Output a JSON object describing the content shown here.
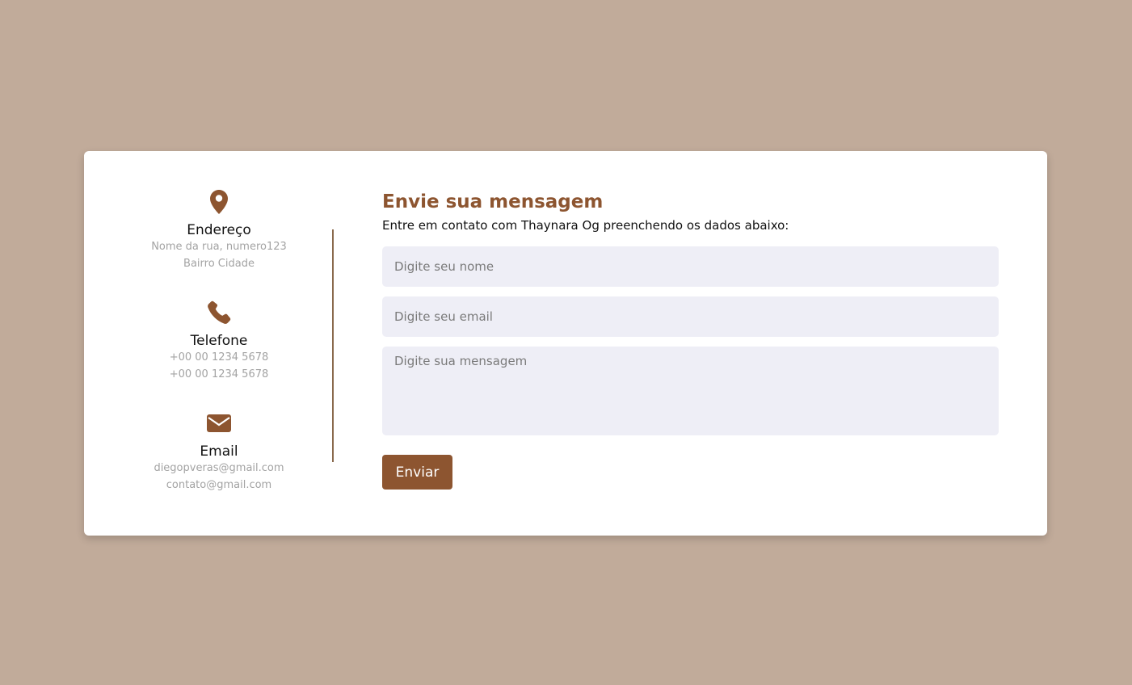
{
  "colors": {
    "background": "#c1ab9a",
    "accent": "#8d5530",
    "field_bg": "#eeeef6",
    "muted_text": "#a3a3a3"
  },
  "contact_info": {
    "address": {
      "icon": "map-pin-icon",
      "title": "Endereço",
      "lines": [
        "Nome da rua, numero123",
        "Bairro Cidade"
      ]
    },
    "phone": {
      "icon": "phone-icon",
      "title": "Telefone",
      "lines": [
        "+00 00 1234 5678",
        "+00 00 1234 5678"
      ]
    },
    "email": {
      "icon": "envelope-icon",
      "title": "Email",
      "lines": [
        "diegopveras@gmail.com",
        "contato@gmail.com"
      ]
    }
  },
  "form": {
    "title": "Envie sua mensagem",
    "subtitle": "Entre em contato com Thaynara Og preenchendo os dados abaixo:",
    "name_placeholder": "Digite seu nome",
    "email_placeholder": "Digite seu email",
    "message_placeholder": "Digite sua mensagem",
    "submit_label": "Enviar"
  }
}
